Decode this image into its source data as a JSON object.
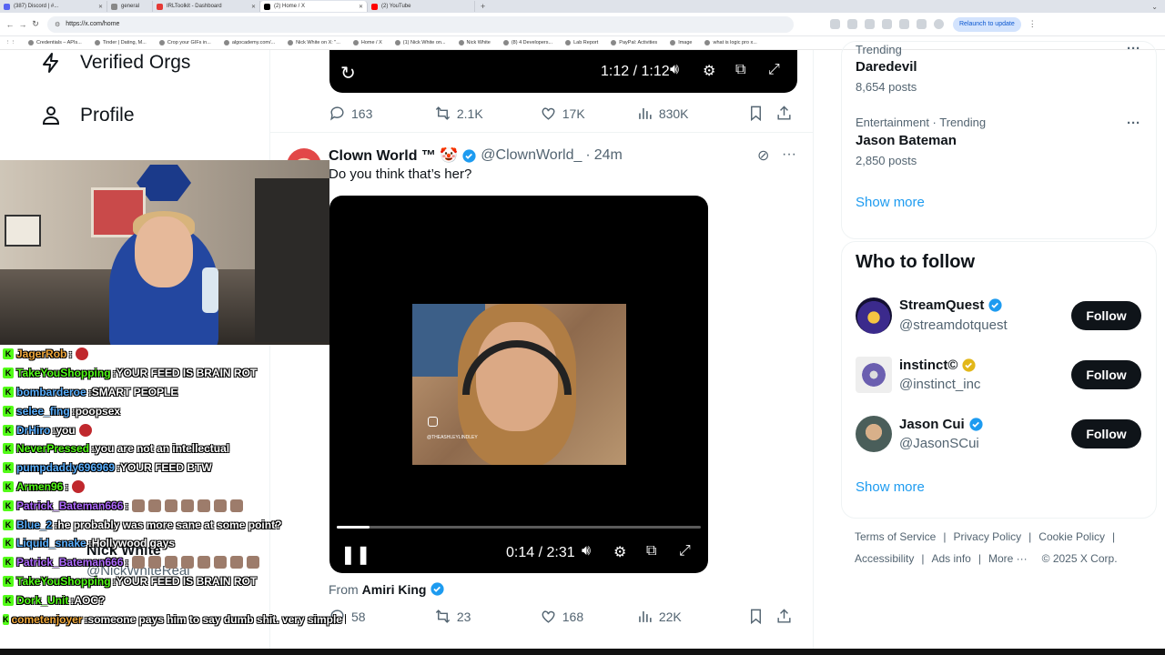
{
  "browser": {
    "tabs": [
      {
        "label": "(387) Discord | #...",
        "color": "#5865f2"
      },
      {
        "label": "general",
        "color": "#888888"
      },
      {
        "label": "IRLToolkit - Dashboard",
        "color": "#e53935"
      },
      {
        "label": "(2) Home / X",
        "color": "#000000"
      },
      {
        "label": "(2) YouTube",
        "color": "#ff0000"
      }
    ],
    "url": "https://x.com/home",
    "relaunch": "Relaunch to update",
    "bookmarks": [
      "Credentials – APIs...",
      "Tinder | Dating, M...",
      "Crop your GIFs in...",
      "algocademy.com/...",
      "Nick White on X: \"...",
      "Home / X",
      "(1) Nick White on...",
      "Nick White",
      "(8) 4 Developers...",
      "Lab Report",
      "PayPal: Activities",
      "Image",
      "what is logic pro x..."
    ]
  },
  "leftnav": {
    "verified_orgs": "Verified Orgs",
    "profile": "Profile"
  },
  "chat": [
    {
      "user": "JagerRob",
      "color": "#f2a93b",
      "msg": "",
      "emotes": [
        "red"
      ]
    },
    {
      "user": "TakeYouShopping",
      "color": "#53fc18",
      "msg": "YOUR FEED IS BRAIN ROT",
      "emotes": []
    },
    {
      "user": "bombarderoe",
      "color": "#5ab0ff",
      "msg": "SMART PEOPLE",
      "emotes": []
    },
    {
      "user": "selee_fing",
      "color": "#5ab0ff",
      "msg": "poopsex",
      "emotes": []
    },
    {
      "user": "DrHiro",
      "color": "#5ab0ff",
      "msg": "you",
      "emotes": [
        "red"
      ]
    },
    {
      "user": "NeverPressed",
      "color": "#53fc18",
      "msg": "you are not an intellectual",
      "emotes": []
    },
    {
      "user": "pumpdaddy696969",
      "color": "#5ab0ff",
      "msg": "YOUR FEED BTW",
      "emotes": []
    },
    {
      "user": "Armen96",
      "color": "#53fc18",
      "msg": "",
      "emotes": [
        "red"
      ]
    },
    {
      "user": "Patrick_Bateman666",
      "color": "#b06bff",
      "msg": "",
      "emotes": [
        "face",
        "face",
        "face",
        "face",
        "face",
        "face",
        "face"
      ]
    },
    {
      "user": "Blue_2",
      "color": "#5ab0ff",
      "msg": "he probably was more sane at some point?",
      "emotes": []
    },
    {
      "user": "Liquid_snake",
      "color": "#5ab0ff",
      "msg": "Hollywood gays",
      "emotes": []
    },
    {
      "user": "Patrick_Bateman666",
      "color": "#b06bff",
      "msg": "",
      "emotes": [
        "face",
        "face",
        "face",
        "face",
        "face",
        "face",
        "face",
        "face"
      ]
    },
    {
      "user": "TakeYouShopping",
      "color": "#53fc18",
      "msg": "YOUR FEED IS BRAIN ROT",
      "emotes": []
    },
    {
      "user": "Dork_Unit",
      "color": "#53fc18",
      "msg": "AOC?",
      "emotes": []
    },
    {
      "user": "cometenjoyer",
      "color": "#f2a93b",
      "msg": "someone pays him to say dumb shit. very simple lol",
      "emotes": []
    }
  ],
  "tweet1": {
    "time": "1:12 / 1:12",
    "replies": "163",
    "reposts": "2.1K",
    "likes": "17K",
    "views": "830K"
  },
  "tweet2": {
    "name": "Clown World ™ 🤡",
    "handle": "@ClownWorld_",
    "time": "24m",
    "text": "Do you think that’s her?",
    "video_time": "0:14 / 2:31",
    "progress": 0.09,
    "watermark": "@THEASHLEYLINDLEY",
    "from_label": "From",
    "from_name": "Amiri King",
    "replies": "58",
    "reposts": "23",
    "likes": "168",
    "views": "22K"
  },
  "mini_profile": {
    "name": "Nick White",
    "handle": "@NickWhiteReal"
  },
  "trends": [
    {
      "category": "Trending",
      "name": "Daredevil",
      "posts": "8,654 posts"
    },
    {
      "category": "Entertainment · Trending",
      "name": "Jason Bateman",
      "posts": "2,850 posts"
    }
  ],
  "show_more": "Show more",
  "who_to_follow": {
    "title": "Who to follow",
    "follow_label": "Follow",
    "accounts": [
      {
        "name": "StreamQuest",
        "handle": "@streamdotquest",
        "badge": "#1d9bf0"
      },
      {
        "name": "instinct©",
        "handle": "@instinct_inc",
        "badge": "#e2b719"
      },
      {
        "name": "Jason Cui",
        "handle": "@JasonSCui",
        "badge": "#1d9bf0"
      }
    ]
  },
  "footer": {
    "terms": "Terms of Service",
    "privacy": "Privacy Policy",
    "cookie": "Cookie Policy",
    "accessibility": "Accessibility",
    "ads": "Ads info",
    "more": "More ···",
    "copyright": "© 2025 X Corp."
  },
  "colors": {
    "accent": "#1d9bf0",
    "text": "#0f1419",
    "secondary": "#536471"
  }
}
